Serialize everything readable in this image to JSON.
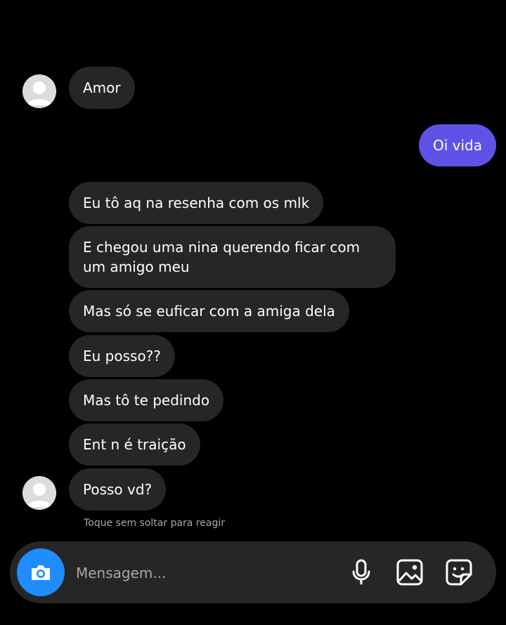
{
  "conversation": {
    "messages": [
      {
        "direction": "received",
        "text": "Amor"
      },
      {
        "direction": "sent",
        "text": "Oi vida"
      },
      {
        "direction": "received",
        "text": "Eu tô aq na resenha com os mlk"
      },
      {
        "direction": "received",
        "text": "E chegou uma nina querendo ficar com um amigo meu"
      },
      {
        "direction": "received",
        "text": "Mas só se euficar com a amiga dela"
      },
      {
        "direction": "received",
        "text": "Eu posso??"
      },
      {
        "direction": "received",
        "text": "Mas tô te pedindo"
      },
      {
        "direction": "received",
        "text": "Ent n é traição"
      },
      {
        "direction": "received",
        "text": "Posso vd?"
      }
    ],
    "reaction_hint": "Toque sem soltar para reagir"
  },
  "composer": {
    "placeholder": "Mensagem...",
    "value": ""
  },
  "colors": {
    "background": "#000000",
    "received_bubble": "#262626",
    "sent_bubble": "#5f52e6",
    "camera_button": "#1f8cff",
    "hint_text": "#a8a8a8"
  },
  "icons": {
    "avatar": "default-avatar-icon",
    "camera": "camera-icon",
    "microphone": "microphone-icon",
    "gallery": "gallery-icon",
    "sticker": "sticker-icon"
  }
}
